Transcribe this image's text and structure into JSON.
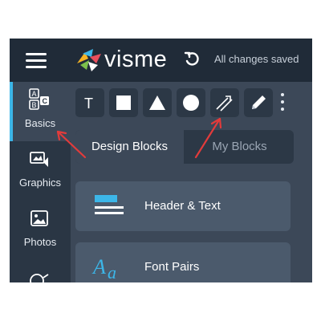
{
  "header": {
    "logo_text": "visme",
    "save_status": "All changes saved"
  },
  "rail": {
    "items": [
      {
        "label": "Basics",
        "active": true
      },
      {
        "label": "Graphics",
        "active": false
      },
      {
        "label": "Photos",
        "active": false
      }
    ]
  },
  "tools": [
    {
      "icon": "text-tool-icon",
      "glyph": "T"
    },
    {
      "icon": "square-tool-icon"
    },
    {
      "icon": "triangle-tool-icon"
    },
    {
      "icon": "circle-tool-icon"
    },
    {
      "icon": "line-arrow-tool-icon"
    },
    {
      "icon": "pencil-tool-icon"
    },
    {
      "icon": "more-vertical-icon"
    }
  ],
  "tabs": [
    {
      "label": "Design Blocks",
      "active": true
    },
    {
      "label": "My Blocks",
      "active": false
    }
  ],
  "blocks": [
    {
      "label": "Header & Text",
      "icon": "header-text-icon"
    },
    {
      "label": "Font Pairs",
      "icon": "font-pairs-icon",
      "icon_text": "Aa"
    }
  ],
  "colors": {
    "topbar": "#202b38",
    "rail": "#2a3644",
    "panel": "#3c4858",
    "block": "#4b5a6c",
    "accent": "#3cb6e8",
    "annotation_arrow": "#e23b3b"
  }
}
